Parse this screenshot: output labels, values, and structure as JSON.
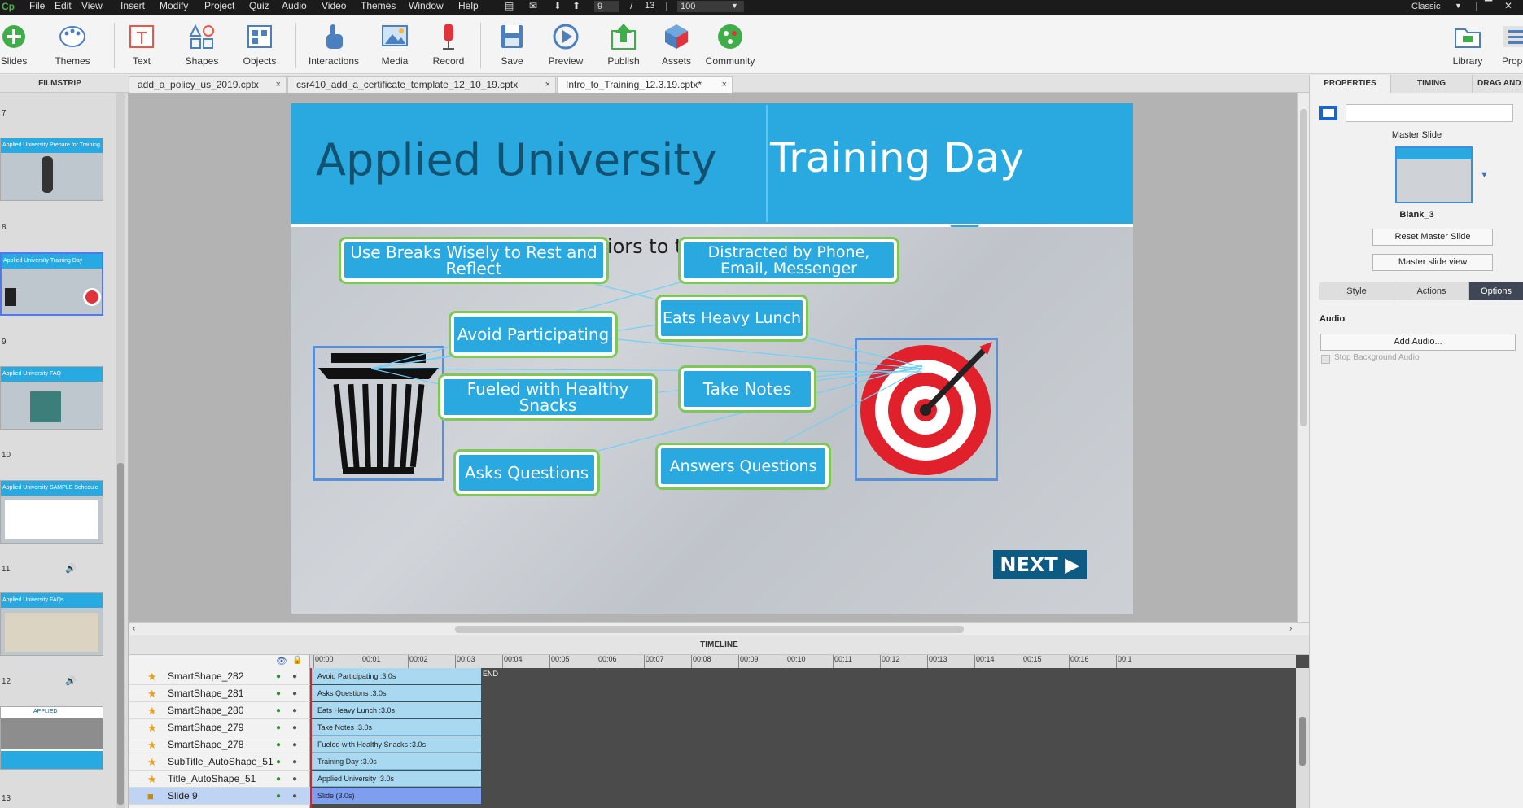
{
  "menubar": {
    "logo": "Cp",
    "menus": [
      "File",
      "Edit",
      "View",
      "Insert",
      "Modify",
      "Project",
      "Quiz",
      "Audio",
      "Video",
      "Themes",
      "Window",
      "Help"
    ],
    "current_slide": "9",
    "slide_separator": "/",
    "total_slides": "13",
    "zoom": "100",
    "mode": "Classic"
  },
  "toolbar": {
    "slides": "Slides",
    "themes": "Themes",
    "text": "Text",
    "shapes": "Shapes",
    "objects": "Objects",
    "interactions": "Interactions",
    "media": "Media",
    "record": "Record",
    "save": "Save",
    "preview": "Preview",
    "publish": "Publish",
    "assets": "Assets",
    "community": "Community",
    "library": "Library",
    "properties": "Prope"
  },
  "panels": {
    "filmstrip": "FILMSTRIP",
    "timeline": "TIMELINE"
  },
  "doc_tabs": [
    {
      "label": "add_a_policy_us_2019.cptx",
      "close": "×"
    },
    {
      "label": "csr410_add_a_certificate_template_12_10_19.cptx",
      "close": "×"
    },
    {
      "label": "Intro_to_Training_12.3.19.cptx*",
      "close": "×"
    }
  ],
  "filmstrip": {
    "slides": [
      {
        "num": "7",
        "title": ""
      },
      {
        "num": "8",
        "title": "Applied University   Prepare for Training"
      },
      {
        "num": "9",
        "title": "Applied University   Training Day"
      },
      {
        "num": "10",
        "title": "Applied University   FAQ"
      },
      {
        "num": "11",
        "title": "Applied University   SAMPLE Schedule"
      },
      {
        "num": "12",
        "title": "Applied University   FAQs"
      },
      {
        "num": "13",
        "title": "APPLIED"
      }
    ]
  },
  "slide": {
    "title_left": "Applied University",
    "title_right": "Training Day",
    "instruction": "Drag and drop the behaviors to the target or the trash.",
    "buttons": {
      "breaks": "Use Breaks Wisely to Rest and Reflect",
      "distracted": "Distracted by Phone, Email, Messenger",
      "lunch": "Eats Heavy Lunch",
      "avoid": "Avoid Participating",
      "snacks": "Fueled with Healthy Snacks",
      "notes": "Take Notes",
      "asks": "Asks Questions",
      "answers": "Answers Questions"
    },
    "next": "NEXT ▶"
  },
  "timeline": {
    "ruler": [
      "00:00",
      "00:01",
      "00:02",
      "00:03",
      "00:04",
      "00:05",
      "00:06",
      "00:07",
      "00:08",
      "00:09",
      "00:10",
      "00:11",
      "00:12",
      "00:13",
      "00:14",
      "00:15",
      "00:16",
      "00:1"
    ],
    "end_label": "END",
    "layers": [
      {
        "name": "SmartShape_282",
        "bar": "Avoid Participating :3.0s"
      },
      {
        "name": "SmartShape_281",
        "bar": "Asks Questions :3.0s"
      },
      {
        "name": "SmartShape_280",
        "bar": "Eats Heavy Lunch :3.0s"
      },
      {
        "name": "SmartShape_279",
        "bar": "Take Notes :3.0s"
      },
      {
        "name": "SmartShape_278",
        "bar": "Fueled with Healthy Snacks :3.0s"
      },
      {
        "name": "SubTitle_AutoShape_51",
        "bar": "Training Day :3.0s"
      },
      {
        "name": "Title_AutoShape_51",
        "bar": "Applied University :3.0s"
      },
      {
        "name": "Slide 9",
        "bar": "Slide (3.0s)"
      }
    ]
  },
  "properties": {
    "tabs": [
      "PROPERTIES",
      "TIMING",
      "DRAG AND"
    ],
    "master_slide_label": "Master Slide",
    "master_name": "Blank_3",
    "reset_btn": "Reset Master Slide",
    "view_btn": "Master slide view",
    "subtabs": [
      "Style",
      "Actions",
      "Options"
    ],
    "audio_label": "Audio",
    "add_audio": "Add Audio...",
    "stop_bg": "Stop Background Audio"
  }
}
